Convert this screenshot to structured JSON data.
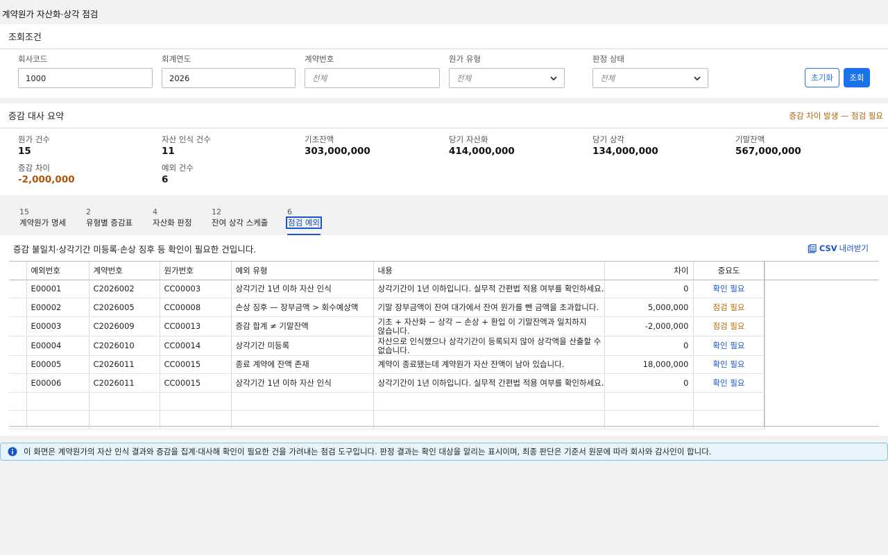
{
  "page": {
    "title": "계약원가 자산화·상각 점검"
  },
  "filter": {
    "title": "조회조건",
    "company": {
      "label": "회사코드",
      "value": "1000"
    },
    "year": {
      "label": "회계연도",
      "value": "2026"
    },
    "contract": {
      "label": "계약번호",
      "placeholder": "전체"
    },
    "cost_type": {
      "label": "원가 유형",
      "value": "전체"
    },
    "status": {
      "label": "판정 상태",
      "value": "전체"
    },
    "reset_label": "초기화",
    "search_label": "조회"
  },
  "summary": {
    "title": "증감 대사 요약",
    "alert": "증감 차이 발생 — 점검 필요",
    "cost_count": {
      "label": "원가 건수",
      "value": "15"
    },
    "asset_count": {
      "label": "자산 인식 건수",
      "value": "11"
    },
    "opening": {
      "label": "기초잔액",
      "value": "303,000,000"
    },
    "capitalized": {
      "label": "당기 자산화",
      "value": "414,000,000"
    },
    "amortized": {
      "label": "당기 상각",
      "value": "134,000,000"
    },
    "closing": {
      "label": "기말잔액",
      "value": "567,000,000"
    },
    "diff": {
      "label": "증감 차이",
      "value": "-2,000,000"
    },
    "exceptions": {
      "label": "예외 건수",
      "value": "6"
    }
  },
  "tabs": [
    {
      "count": "15",
      "label": "계약원가 명세"
    },
    {
      "count": "2",
      "label": "유형별 증감표"
    },
    {
      "count": "4",
      "label": "자산화 판정"
    },
    {
      "count": "12",
      "label": "잔여 상각 스케줄"
    },
    {
      "count": "6",
      "label": "점검 예외",
      "active": true
    }
  ],
  "exceptions": {
    "description": "증감 불일치·상각기간 미등록·손상 징후 등 확인이 필요한 건입니다.",
    "csv_bold": "CSV",
    "csv_label": "내려받기",
    "columns": [
      "예외번호",
      "계약번호",
      "원가번호",
      "예외 유형",
      "내용",
      "차이",
      "중요도"
    ],
    "rows": [
      {
        "id": "E00001",
        "contract": "C2026002",
        "cost": "CC00003",
        "type": "상각기간 1년 이하 자산 인식",
        "content": "상각기간이 1년 이하입니다. 실무적 간편법 적용 여부를 확인하세요.",
        "diff": "0",
        "level": "확인 필요",
        "level_color": "#1a55c8"
      },
      {
        "id": "E00002",
        "contract": "C2026005",
        "cost": "CC00008",
        "type": "손상 징후 — 장부금액 > 회수예상액",
        "content": "기말 장부금액이 잔여 대가에서 잔여 원가를 뺀 금액을 초과합니다.",
        "diff": "5,000,000",
        "level": "점검 필요",
        "level_color": "#b86d0a"
      },
      {
        "id": "E00003",
        "contract": "C2026009",
        "cost": "CC00013",
        "type": "증감 합계 ≠ 기말잔액",
        "content": "기초 + 자산화 − 상각 − 손상 + 환입 이 기말잔액과 일치하지 않습니다.",
        "diff": "-2,000,000",
        "level": "점검 필요",
        "level_color": "#b86d0a"
      },
      {
        "id": "E00004",
        "contract": "C2026010",
        "cost": "CC00014",
        "type": "상각기간 미등록",
        "content": "자산으로 인식했으나 상각기간이 등록되지 않아 상각액을 산출할 수 없습니다.",
        "diff": "0",
        "level": "확인 필요",
        "level_color": "#1a55c8"
      },
      {
        "id": "E00005",
        "contract": "C2026011",
        "cost": "CC00015",
        "type": "종료 계약에 잔액 존재",
        "content": "계약이 종료됐는데 계약원가 자산 잔액이 남아 있습니다.",
        "diff": "18,000,000",
        "level": "확인 필요",
        "level_color": "#1a55c8"
      },
      {
        "id": "E00006",
        "contract": "C2026011",
        "cost": "CC00015",
        "type": "상각기간 1년 이하 자산 인식",
        "content": "상각기간이 1년 이하입니다. 실무적 간편법 적용 여부를 확인하세요.",
        "diff": "0",
        "level": "확인 필요",
        "level_color": "#1a55c8"
      }
    ]
  },
  "notice": "이 화면은 계약원가의 자산 인식 결과와 증감을 집계·대사해 확인이 필요한 건을 가려내는 점검 도구입니다. 판정 결과는 확인 대상을 알리는 표시이며, 최종 판단은 기준서 원문에 따라 회사와 감사인이 합니다.",
  "icons": {
    "csv": "spreadsheet-icon",
    "notice": "info-icon",
    "select": "chevron-down-icon"
  }
}
